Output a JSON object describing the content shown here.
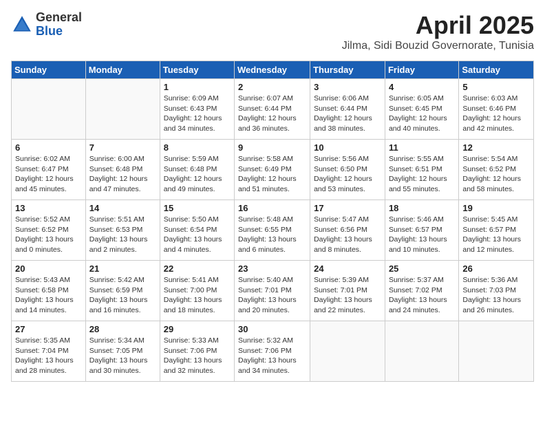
{
  "logo": {
    "general": "General",
    "blue": "Blue"
  },
  "title": "April 2025",
  "location": "Jilma, Sidi Bouzid Governorate, Tunisia",
  "days_header": [
    "Sunday",
    "Monday",
    "Tuesday",
    "Wednesday",
    "Thursday",
    "Friday",
    "Saturday"
  ],
  "weeks": [
    [
      {
        "num": "",
        "info": ""
      },
      {
        "num": "",
        "info": ""
      },
      {
        "num": "1",
        "info": "Sunrise: 6:09 AM\nSunset: 6:43 PM\nDaylight: 12 hours\nand 34 minutes."
      },
      {
        "num": "2",
        "info": "Sunrise: 6:07 AM\nSunset: 6:44 PM\nDaylight: 12 hours\nand 36 minutes."
      },
      {
        "num": "3",
        "info": "Sunrise: 6:06 AM\nSunset: 6:44 PM\nDaylight: 12 hours\nand 38 minutes."
      },
      {
        "num": "4",
        "info": "Sunrise: 6:05 AM\nSunset: 6:45 PM\nDaylight: 12 hours\nand 40 minutes."
      },
      {
        "num": "5",
        "info": "Sunrise: 6:03 AM\nSunset: 6:46 PM\nDaylight: 12 hours\nand 42 minutes."
      }
    ],
    [
      {
        "num": "6",
        "info": "Sunrise: 6:02 AM\nSunset: 6:47 PM\nDaylight: 12 hours\nand 45 minutes."
      },
      {
        "num": "7",
        "info": "Sunrise: 6:00 AM\nSunset: 6:48 PM\nDaylight: 12 hours\nand 47 minutes."
      },
      {
        "num": "8",
        "info": "Sunrise: 5:59 AM\nSunset: 6:48 PM\nDaylight: 12 hours\nand 49 minutes."
      },
      {
        "num": "9",
        "info": "Sunrise: 5:58 AM\nSunset: 6:49 PM\nDaylight: 12 hours\nand 51 minutes."
      },
      {
        "num": "10",
        "info": "Sunrise: 5:56 AM\nSunset: 6:50 PM\nDaylight: 12 hours\nand 53 minutes."
      },
      {
        "num": "11",
        "info": "Sunrise: 5:55 AM\nSunset: 6:51 PM\nDaylight: 12 hours\nand 55 minutes."
      },
      {
        "num": "12",
        "info": "Sunrise: 5:54 AM\nSunset: 6:52 PM\nDaylight: 12 hours\nand 58 minutes."
      }
    ],
    [
      {
        "num": "13",
        "info": "Sunrise: 5:52 AM\nSunset: 6:52 PM\nDaylight: 13 hours\nand 0 minutes."
      },
      {
        "num": "14",
        "info": "Sunrise: 5:51 AM\nSunset: 6:53 PM\nDaylight: 13 hours\nand 2 minutes."
      },
      {
        "num": "15",
        "info": "Sunrise: 5:50 AM\nSunset: 6:54 PM\nDaylight: 13 hours\nand 4 minutes."
      },
      {
        "num": "16",
        "info": "Sunrise: 5:48 AM\nSunset: 6:55 PM\nDaylight: 13 hours\nand 6 minutes."
      },
      {
        "num": "17",
        "info": "Sunrise: 5:47 AM\nSunset: 6:56 PM\nDaylight: 13 hours\nand 8 minutes."
      },
      {
        "num": "18",
        "info": "Sunrise: 5:46 AM\nSunset: 6:57 PM\nDaylight: 13 hours\nand 10 minutes."
      },
      {
        "num": "19",
        "info": "Sunrise: 5:45 AM\nSunset: 6:57 PM\nDaylight: 13 hours\nand 12 minutes."
      }
    ],
    [
      {
        "num": "20",
        "info": "Sunrise: 5:43 AM\nSunset: 6:58 PM\nDaylight: 13 hours\nand 14 minutes."
      },
      {
        "num": "21",
        "info": "Sunrise: 5:42 AM\nSunset: 6:59 PM\nDaylight: 13 hours\nand 16 minutes."
      },
      {
        "num": "22",
        "info": "Sunrise: 5:41 AM\nSunset: 7:00 PM\nDaylight: 13 hours\nand 18 minutes."
      },
      {
        "num": "23",
        "info": "Sunrise: 5:40 AM\nSunset: 7:01 PM\nDaylight: 13 hours\nand 20 minutes."
      },
      {
        "num": "24",
        "info": "Sunrise: 5:39 AM\nSunset: 7:01 PM\nDaylight: 13 hours\nand 22 minutes."
      },
      {
        "num": "25",
        "info": "Sunrise: 5:37 AM\nSunset: 7:02 PM\nDaylight: 13 hours\nand 24 minutes."
      },
      {
        "num": "26",
        "info": "Sunrise: 5:36 AM\nSunset: 7:03 PM\nDaylight: 13 hours\nand 26 minutes."
      }
    ],
    [
      {
        "num": "27",
        "info": "Sunrise: 5:35 AM\nSunset: 7:04 PM\nDaylight: 13 hours\nand 28 minutes."
      },
      {
        "num": "28",
        "info": "Sunrise: 5:34 AM\nSunset: 7:05 PM\nDaylight: 13 hours\nand 30 minutes."
      },
      {
        "num": "29",
        "info": "Sunrise: 5:33 AM\nSunset: 7:06 PM\nDaylight: 13 hours\nand 32 minutes."
      },
      {
        "num": "30",
        "info": "Sunrise: 5:32 AM\nSunset: 7:06 PM\nDaylight: 13 hours\nand 34 minutes."
      },
      {
        "num": "",
        "info": ""
      },
      {
        "num": "",
        "info": ""
      },
      {
        "num": "",
        "info": ""
      }
    ]
  ]
}
